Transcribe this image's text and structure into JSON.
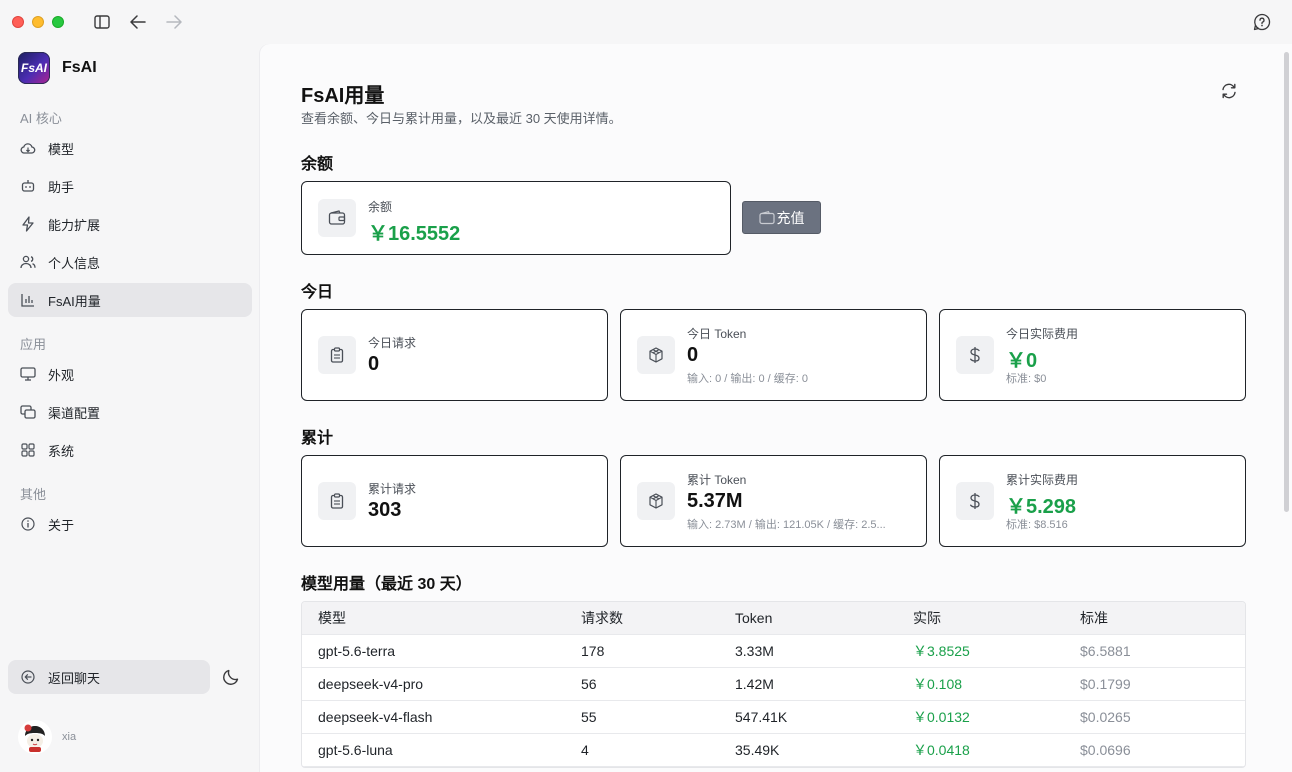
{
  "app": {
    "name": "FsAI",
    "logo_text": "FsAI"
  },
  "sidebar": {
    "sections": [
      {
        "label": "AI 核心"
      },
      {
        "label": "应用"
      },
      {
        "label": "其他"
      }
    ],
    "items": [
      {
        "label": "模型",
        "icon": "cloud-icon"
      },
      {
        "label": "助手",
        "icon": "robot-icon"
      },
      {
        "label": "能力扩展",
        "icon": "lightning-icon"
      },
      {
        "label": "个人信息",
        "icon": "users-icon"
      },
      {
        "label": "FsAI用量",
        "icon": "bar-chart-icon",
        "active": true
      },
      {
        "label": "外观",
        "icon": "monitor-icon"
      },
      {
        "label": "渠道配置",
        "icon": "channel-icon"
      },
      {
        "label": "系统",
        "icon": "grid-icon"
      },
      {
        "label": "关于",
        "icon": "info-icon"
      }
    ],
    "back_label": "返回聊天",
    "user": {
      "name": "xia"
    }
  },
  "page": {
    "title": "FsAI用量",
    "subtitle": "查看余额、今日与累计用量，以及最近 30 天使用详情。"
  },
  "balance": {
    "heading": "余额",
    "label": "余额",
    "value": "￥16.5552",
    "charge_label": "充值"
  },
  "today": {
    "heading": "今日",
    "requests": {
      "label": "今日请求",
      "value": "0"
    },
    "tokens": {
      "label": "今日 Token",
      "value": "0",
      "sub": "输入: 0 / 输出: 0 / 缓存: 0"
    },
    "cost": {
      "label": "今日实际费用",
      "value": "￥0",
      "sub": "标准: $0"
    }
  },
  "total": {
    "heading": "累计",
    "requests": {
      "label": "累计请求",
      "value": "303"
    },
    "tokens": {
      "label": "累计 Token",
      "value": "5.37M",
      "sub": "输入: 2.73M / 输出: 121.05K / 缓存: 2.5..."
    },
    "cost": {
      "label": "累计实际费用",
      "value": "￥5.298",
      "sub": "标准: $8.516"
    }
  },
  "model_usage": {
    "heading": "模型用量（最近 30 天）",
    "columns": [
      "模型",
      "请求数",
      "Token",
      "实际",
      "标准"
    ],
    "rows": [
      {
        "model": "gpt-5.6-terra",
        "requests": "178",
        "tokens": "3.33M",
        "actual": "￥3.8525",
        "standard": "$6.5881"
      },
      {
        "model": "deepseek-v4-pro",
        "requests": "56",
        "tokens": "1.42M",
        "actual": "￥0.108",
        "standard": "$0.1799"
      },
      {
        "model": "deepseek-v4-flash",
        "requests": "55",
        "tokens": "547.41K",
        "actual": "￥0.0132",
        "standard": "$0.0265"
      },
      {
        "model": "gpt-5.6-luna",
        "requests": "4",
        "tokens": "35.49K",
        "actual": "￥0.0418",
        "standard": "$0.0696"
      }
    ]
  },
  "colors": {
    "accent_green": "#1aa04a",
    "charge_button": "#6b7280"
  }
}
